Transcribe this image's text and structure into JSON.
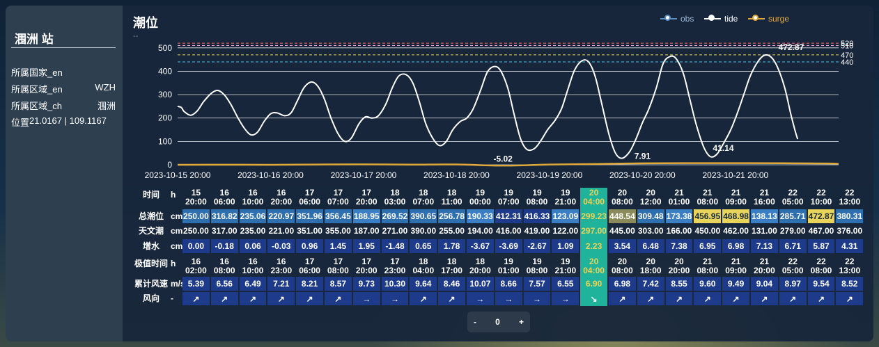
{
  "station": {
    "name": "涠洲 站"
  },
  "info": [
    {
      "label": "所属国家_en",
      "value": ""
    },
    {
      "label": "所属区域_en",
      "value": "WZH"
    },
    {
      "label": "所属区域_ch",
      "value": "涠洲"
    },
    {
      "label": "位置",
      "value": "21.0167 | 109.1167"
    }
  ],
  "panel": {
    "title": "潮位",
    "subtitle": "--"
  },
  "legend": [
    {
      "name": "obs",
      "color": "#5b8cc4",
      "text_color": "#9fb8d6"
    },
    {
      "name": "tide",
      "color": "#ffffff",
      "text_color": "#ffffff"
    },
    {
      "name": "surge",
      "color": "#e0a93a",
      "text_color": "#e0a93a"
    }
  ],
  "chart_data": {
    "type": "line",
    "ylim": [
      0,
      550
    ],
    "yticks": [
      0,
      100,
      200,
      300,
      400,
      500
    ],
    "x_tick_labels": [
      "2023-10-15 20:00",
      "2023-10-16 20:00",
      "2023-10-17 20:00",
      "2023-10-18 20:00",
      "2023-10-19 20:00",
      "2023-10-20 20:00",
      "2023-10-21 20:00"
    ],
    "x_range_days": [
      0,
      7.11
    ],
    "grid": true,
    "warning_levels": [
      {
        "value": 520,
        "label": "520",
        "color": "#ff6b6b"
      },
      {
        "value": 510,
        "label": "510",
        "color": "#f5a5c8"
      },
      {
        "value": 470,
        "label": "470",
        "color": "#e8d45a"
      },
      {
        "value": 440,
        "label": "440",
        "color": "#4fc3e6"
      }
    ],
    "series": [
      {
        "name": "tide",
        "color": "#ffffff",
        "x_days": [
          0,
          0.04,
          0.07,
          0.14,
          0.21,
          0.28,
          0.36,
          0.43,
          0.5,
          0.57,
          0.65,
          0.72,
          0.79,
          0.86,
          0.93,
          1.0,
          1.07,
          1.15,
          1.22,
          1.29,
          1.36,
          1.44,
          1.51,
          1.58,
          1.65,
          1.73,
          1.8,
          1.87,
          1.95,
          2.02,
          2.09,
          2.16,
          2.24,
          2.31,
          2.38,
          2.46,
          2.53,
          2.6,
          2.67,
          2.75,
          2.82,
          2.89,
          2.96,
          3.04,
          3.11,
          3.18,
          3.26,
          3.33,
          3.4,
          3.47,
          3.55,
          3.62,
          3.69,
          3.76,
          3.84,
          3.91,
          3.98,
          4.06,
          4.13,
          4.2,
          4.27,
          4.35,
          4.42,
          4.49,
          4.56,
          4.64,
          4.71,
          4.78,
          4.86,
          4.93,
          5.0,
          5.07,
          5.15,
          5.22,
          5.29,
          5.36,
          5.44,
          5.51,
          5.58,
          5.66,
          5.73,
          5.8,
          5.87,
          5.95,
          6.02,
          6.09,
          6.16,
          6.24,
          6.31,
          6.38,
          6.45,
          6.53,
          6.6,
          6.67,
          6.74,
          6.82,
          6.89,
          6.96,
          7.04,
          7.11
        ],
        "values": [
          250,
          245,
          228,
          212,
          230,
          270,
          305,
          318,
          300,
          260,
          200,
          155,
          128,
          140,
          185,
          218,
          222,
          210,
          222,
          275,
          330,
          354,
          335,
          280,
          200,
          130,
          100,
          115,
          175,
          205,
          200,
          210,
          260,
          330,
          380,
          385,
          350,
          270,
          175,
          110,
          82,
          100,
          150,
          185,
          200,
          240,
          320,
          395,
          420,
          405,
          330,
          215,
          110,
          65,
          70,
          105,
          150,
          190,
          240,
          325,
          405,
          445,
          440,
          380,
          265,
          130,
          50,
          28,
          55,
          110,
          180,
          240,
          330,
          430,
          462,
          455,
          390,
          280,
          170,
          75,
          35,
          45,
          90,
          150,
          220,
          300,
          380,
          440,
          468,
          462,
          420,
          330,
          210,
          110,
          62
        ]
      },
      {
        "name": "surge",
        "color": "#e0a93a",
        "x_days": [
          0,
          0.5,
          1.0,
          1.5,
          2.0,
          2.5,
          3.0,
          3.5,
          4.0,
          4.5,
          5.0,
          5.5,
          6.0,
          6.5,
          7.0,
          7.11
        ],
        "values": [
          0,
          0.5,
          -0.1,
          1.2,
          1.9,
          0.8,
          1.5,
          -3.5,
          1.1,
          3.5,
          6.5,
          7.2,
          7.0,
          6.8,
          5.5,
          4.3
        ]
      }
    ],
    "annotations": [
      {
        "text": "-5.02",
        "x_day": 3.5,
        "y": -5.02
      },
      {
        "text": "7.91",
        "x_day": 5.0,
        "y": 7.91
      },
      {
        "text": "41.14",
        "x_day": 5.87,
        "y": 41.14
      },
      {
        "text": "472.87",
        "x_day": 6.6,
        "y": 472.87
      }
    ]
  },
  "table": {
    "label_time": "时间",
    "unit_time": "h",
    "label_total": "总潮位",
    "unit_total": "cm",
    "label_astro": "天文潮",
    "unit_astro": "cm",
    "label_surge": "增水",
    "unit_surge": "cm",
    "label_ext": "极值时间",
    "unit_ext": "h",
    "label_wind": "累计风速",
    "unit_wind": "m/s",
    "label_dir": "风向",
    "unit_dir": "-",
    "highlight_index": 14,
    "times": [
      [
        "15",
        "20:00"
      ],
      [
        "16",
        "06:00"
      ],
      [
        "16",
        "10:00"
      ],
      [
        "16",
        "20:00"
      ],
      [
        "17",
        "06:00"
      ],
      [
        "17",
        "07:00"
      ],
      [
        "17",
        "20:00"
      ],
      [
        "18",
        "03:00"
      ],
      [
        "18",
        "07:00"
      ],
      [
        "18",
        "11:00"
      ],
      [
        "19",
        "00:00"
      ],
      [
        "19",
        "07:00"
      ],
      [
        "19",
        "08:00"
      ],
      [
        "19",
        "21:00"
      ],
      [
        "20",
        "04:00"
      ],
      [
        "20",
        "08:00"
      ],
      [
        "20",
        "12:00"
      ],
      [
        "21",
        "01:00"
      ],
      [
        "21",
        "08:00"
      ],
      [
        "21",
        "09:00"
      ],
      [
        "21",
        "16:00"
      ],
      [
        "22",
        "05:00"
      ],
      [
        "22",
        "10:00"
      ],
      [
        "22",
        "13:00"
      ]
    ],
    "total": [
      "250.00",
      "316.82",
      "235.06",
      "220.97",
      "351.96",
      "356.45",
      "188.95",
      "269.52",
      "390.65",
      "256.78",
      "190.33",
      "412.31",
      "416.33",
      "123.09",
      "299.23",
      "448.54",
      "309.48",
      "173.38",
      "456.95",
      "468.98",
      "138.13",
      "285.71",
      "472.87",
      "380.31"
    ],
    "total_colors": [
      "#2e6fb0",
      "#2e6fb0",
      "#2e6fb0",
      "#2e6fb0",
      "#2e6fb0",
      "#2e6fb0",
      "#3a7fc6",
      "#2e6fb0",
      "#2e6fb0",
      "#2e6fb0",
      "#3a7fc6",
      "#1e3a8a",
      "#1e3a8a",
      "#3a7fc6",
      "#1fb39b",
      "#8a8a5a",
      "#2e6fb0",
      "#3a7fc6",
      "#e8d45a",
      "#e8d45a",
      "#3a7fc6",
      "#2e6fb0",
      "#e8d45a",
      "#2e6fb0"
    ],
    "astro": [
      "250.00",
      "317.00",
      "235.00",
      "221.00",
      "351.00",
      "355.00",
      "187.00",
      "271.00",
      "390.00",
      "255.00",
      "194.00",
      "416.00",
      "419.00",
      "122.00",
      "297.00",
      "445.00",
      "303.00",
      "166.00",
      "450.00",
      "462.00",
      "131.00",
      "279.00",
      "467.00",
      "376.00"
    ],
    "surge": [
      "0.00",
      "-0.18",
      "0.06",
      "-0.03",
      "0.96",
      "1.45",
      "1.95",
      "-1.48",
      "0.65",
      "1.78",
      "-3.67",
      "-3.69",
      "-2.67",
      "1.09",
      "2.23",
      "3.54",
      "6.48",
      "7.38",
      "6.95",
      "6.98",
      "7.13",
      "6.71",
      "5.87",
      "4.31"
    ],
    "ext_times": [
      [
        "16",
        "02:00"
      ],
      [
        "16",
        "08:00"
      ],
      [
        "16",
        "10:00"
      ],
      [
        "16",
        "23:00"
      ],
      [
        "17",
        "06:00"
      ],
      [
        "17",
        "08:00"
      ],
      [
        "17",
        "20:00"
      ],
      [
        "17",
        "23:00"
      ],
      [
        "18",
        "04:00"
      ],
      [
        "18",
        "17:00"
      ],
      [
        "18",
        "20:00"
      ],
      [
        "19",
        "01:00"
      ],
      [
        "19",
        "08:00"
      ],
      [
        "19",
        "21:00"
      ],
      [
        "20",
        "04:00"
      ],
      [
        "20",
        "08:00"
      ],
      [
        "20",
        "18:00"
      ],
      [
        "20",
        "20:00"
      ],
      [
        "21",
        "08:00"
      ],
      [
        "21",
        "09:00"
      ],
      [
        "21",
        "20:00"
      ],
      [
        "22",
        "05:00"
      ],
      [
        "22",
        "08:00"
      ],
      [
        "22",
        "13:00"
      ]
    ],
    "wind": [
      "5.39",
      "6.56",
      "6.49",
      "7.21",
      "8.21",
      "8.57",
      "9.73",
      "10.30",
      "9.64",
      "8.46",
      "10.07",
      "8.66",
      "7.57",
      "6.55",
      "6.90",
      "6.98",
      "7.42",
      "8.55",
      "9.60",
      "9.49",
      "9.04",
      "8.97",
      "9.54",
      "8.52"
    ],
    "dir": [
      "↗",
      "↗",
      "↗",
      "↗",
      "↗",
      "↗",
      "→",
      "→",
      "↗",
      "↗",
      "→",
      "→",
      "→",
      "→",
      "↘",
      "↗",
      "↗",
      "↗",
      "↗",
      "↗",
      "↗",
      "↗",
      "↗",
      "↗"
    ]
  },
  "pager": {
    "prev": "-",
    "value": "0",
    "next": "+"
  }
}
